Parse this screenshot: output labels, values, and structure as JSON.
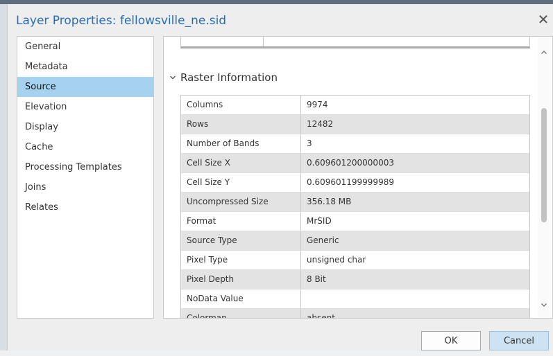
{
  "window": {
    "title": "Layer Properties: fellowsville_ne.sid",
    "close_icon": "close-icon"
  },
  "nav": {
    "items": [
      {
        "label": "General",
        "active": false
      },
      {
        "label": "Metadata",
        "active": false
      },
      {
        "label": "Source",
        "active": true
      },
      {
        "label": "Elevation",
        "active": false
      },
      {
        "label": "Display",
        "active": false
      },
      {
        "label": "Cache",
        "active": false
      },
      {
        "label": "Processing Templates",
        "active": false
      },
      {
        "label": "Joins",
        "active": false
      },
      {
        "label": "Relates",
        "active": false
      }
    ]
  },
  "section": {
    "title": "Raster Information",
    "rows": [
      {
        "name": "Columns",
        "value": "9974"
      },
      {
        "name": "Rows",
        "value": "12482"
      },
      {
        "name": "Number of Bands",
        "value": "3"
      },
      {
        "name": "Cell Size X",
        "value": "0.609601200000003"
      },
      {
        "name": "Cell Size Y",
        "value": "0.609601199999989"
      },
      {
        "name": "Uncompressed Size",
        "value": "356.18 MB"
      },
      {
        "name": "Format",
        "value": "MrSID"
      },
      {
        "name": "Source Type",
        "value": "Generic"
      },
      {
        "name": "Pixel Type",
        "value": "unsigned char"
      },
      {
        "name": "Pixel Depth",
        "value": "8 Bit"
      },
      {
        "name": "NoData Value",
        "value": ""
      },
      {
        "name": "Colormap",
        "value": "absent"
      }
    ]
  },
  "buttons": {
    "ok": "OK",
    "cancel": "Cancel"
  },
  "colors": {
    "title": "#2a6db5",
    "selected": "#a5d3ef",
    "cancel_bg": "#cde2f3"
  }
}
